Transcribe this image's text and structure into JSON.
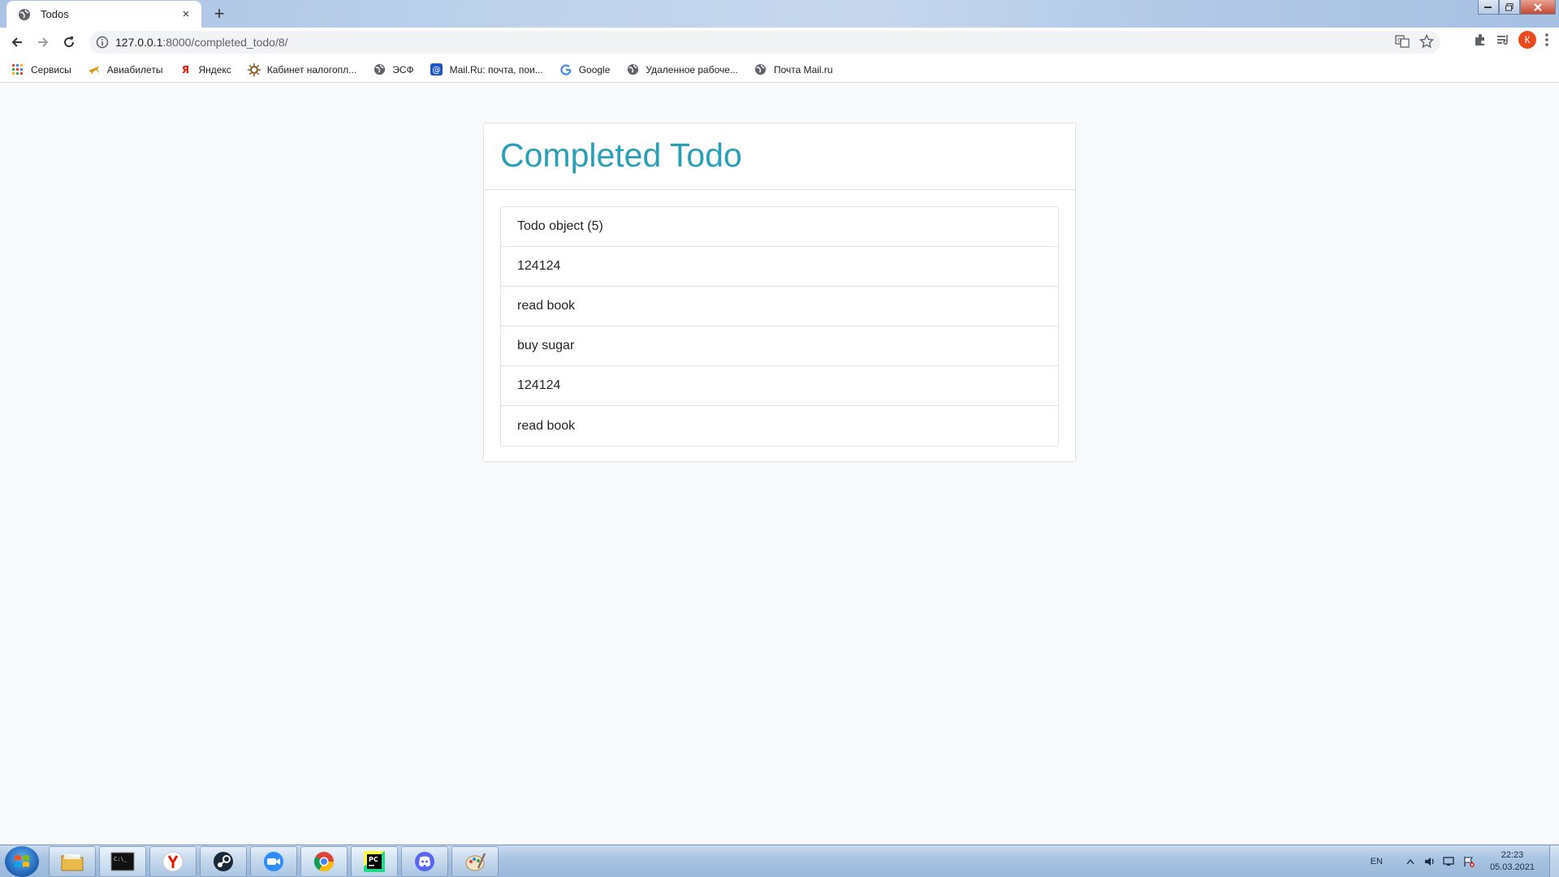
{
  "browser": {
    "tab_title": "Todos",
    "tab_close": "×",
    "new_tab": "+",
    "url_host": "127.0.0.1",
    "url_path": ":8000/completed_todo/8/",
    "profile_initial": "К",
    "profile_color": "#e8491d"
  },
  "bookmarks": [
    {
      "label": "Сервисы",
      "icon": "apps-grid-icon"
    },
    {
      "label": "Авиабилеты",
      "icon": "airplane-icon"
    },
    {
      "label": "Яндекс",
      "icon": "yandex-icon"
    },
    {
      "label": "Кабинет налогопл...",
      "icon": "sun-icon"
    },
    {
      "label": "ЭСФ",
      "icon": "globe-icon"
    },
    {
      "label": "Mail.Ru: почта, пои...",
      "icon": "mail-at-icon"
    },
    {
      "label": "Google",
      "icon": "google-icon"
    },
    {
      "label": "Удаленное рабоче...",
      "icon": "globe-icon"
    },
    {
      "label": "Почта Mail.ru",
      "icon": "globe-icon"
    }
  ],
  "page": {
    "title": "Completed Todo",
    "title_color": "#2aa0b7",
    "items": [
      "Todo object (5)",
      "124124",
      "read book",
      "buy sugar",
      "124124",
      "read book"
    ]
  },
  "taskbar": {
    "apps": [
      "file-explorer-icon",
      "terminal-icon",
      "yandex-browser-icon",
      "steam-icon",
      "zoom-icon",
      "chrome-icon",
      "pycharm-icon",
      "discord-icon",
      "paint-icon"
    ],
    "language": "EN",
    "time": "22:23",
    "date": "05.03.2021"
  }
}
